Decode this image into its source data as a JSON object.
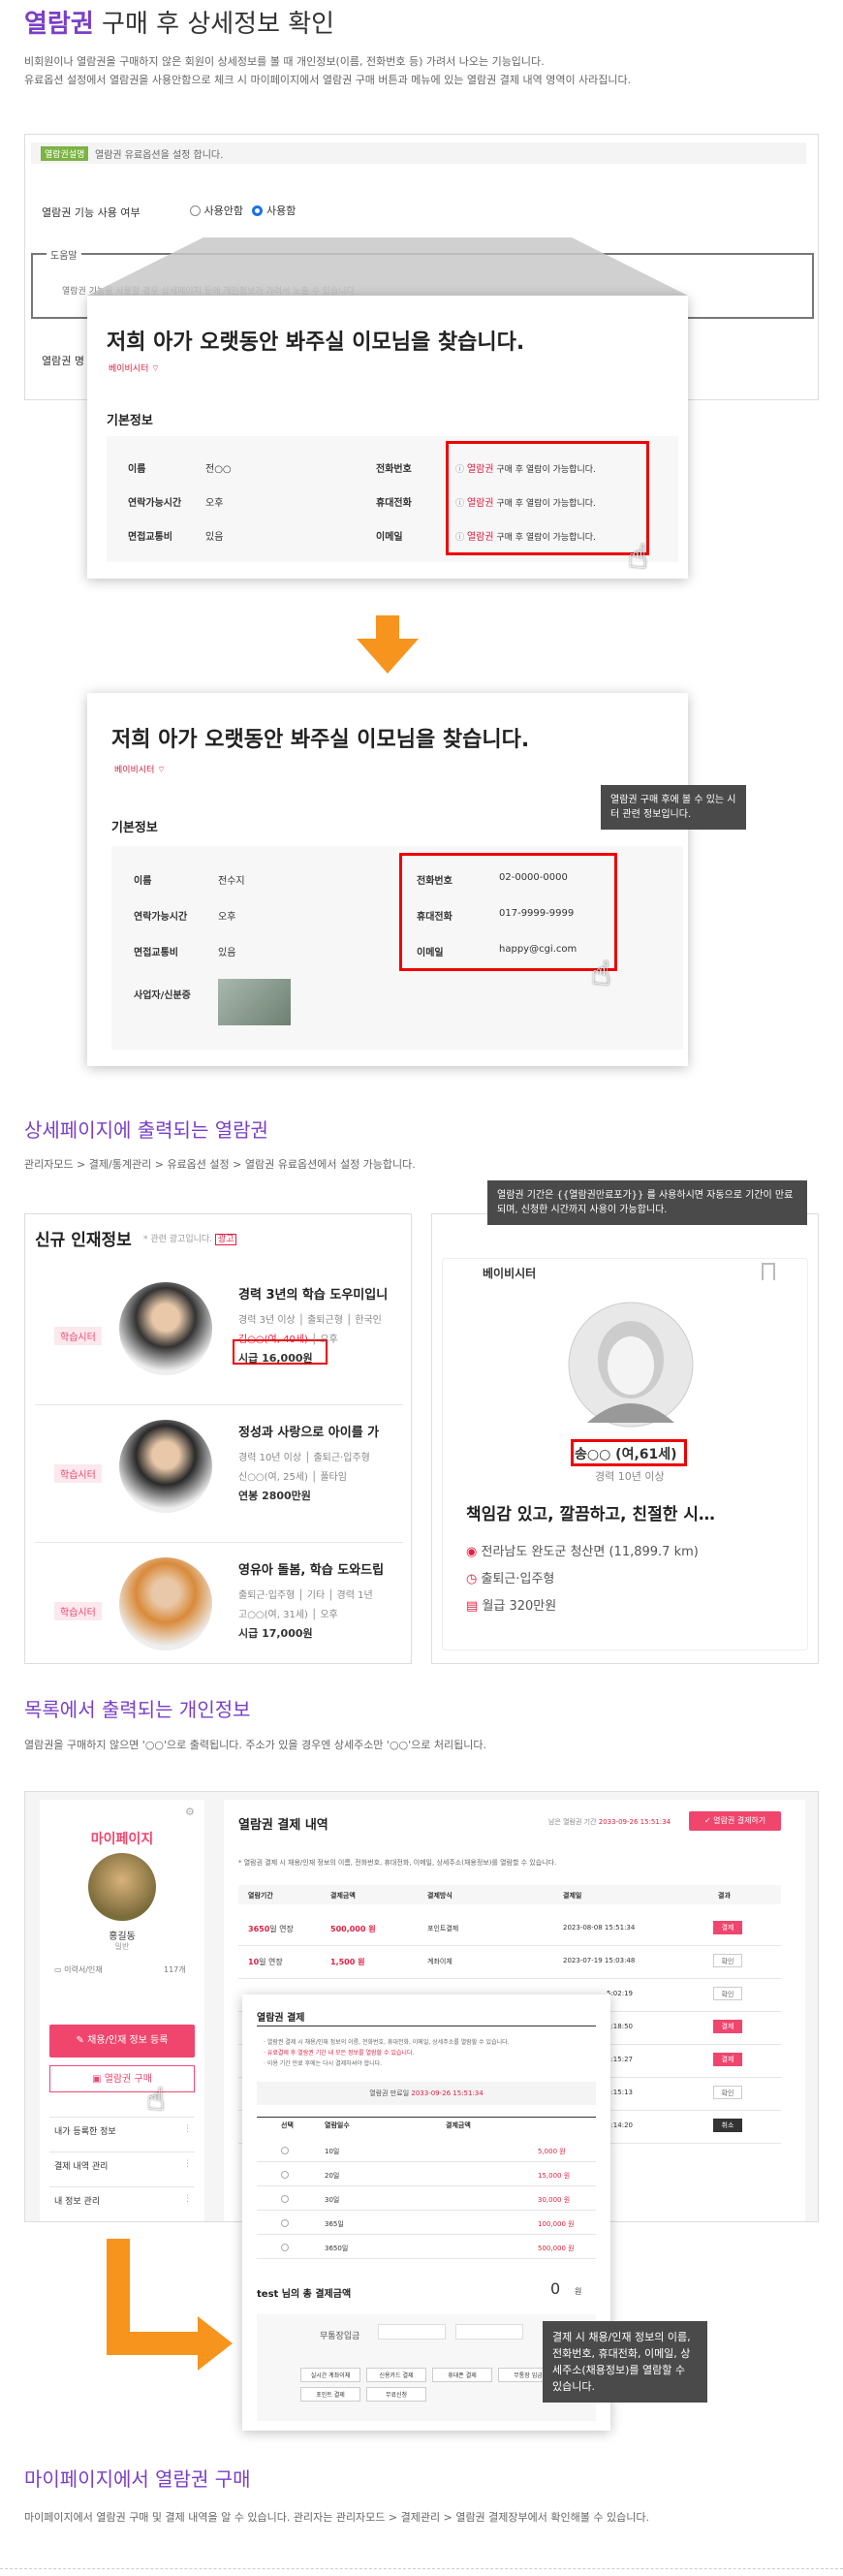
{
  "section1": {
    "title_strong": "열람권",
    "title_rest": " 구매 후 상세정보 확인",
    "desc1": "비회원이나 열람권을 구매하지 않은 회원이 상세정보를 볼 때 개인정보(이름, 전화번호 등) 가려서 나오는 기능입니다.",
    "desc2": "유료옵션 설정에서 열람권을 사용안함으로 체크 시 마이페이지에서 열람권 구매 버튼과 메뉴에 있는 열람권 결제 내역 영역이 사라집니다.",
    "admin_tag": "열람권",
    "admin_tag2": "설명",
    "admin_note": "열람권 유료옵션을 설정 합니다.",
    "use_label": "열람권 기능 사용 여부",
    "opt_off": "사용안함",
    "opt_on": "사용함",
    "help_label": "도움말",
    "help_text": "열람권 기능을 사용할 경우 상세페이지 등에 개인정보가 가려서 노출 수 있습니다.",
    "row2_label": "열람권 명"
  },
  "before_card": {
    "title": "저희 아가 오랫동안 봐주실 이모님을 찾습니다.",
    "badge": "베이비시터",
    "badge_icon": "wifi-icon",
    "section": "기본정보",
    "rows": [
      {
        "l1": "이름",
        "v1": "전○○",
        "l2": "전화번호",
        "lock": "열람권",
        "v2": " 구매 후 열람이 가능합니다."
      },
      {
        "l1": "연락가능시간",
        "v1": "오후",
        "l2": "휴대전화",
        "lock": "열람권",
        "v2": " 구매 후 열람이 가능합니다."
      },
      {
        "l1": "면접교통비",
        "v1": "있음",
        "l2": "이메일",
        "lock": "열람권",
        "v2": " 구매 후 열람이 가능합니다."
      }
    ]
  },
  "after_card": {
    "title": "저희 아가 오랫동안 봐주실 이모님을 찾습니다.",
    "badge": "베이비시터",
    "section": "기본정보",
    "callout": "열람권 구매 후에 볼 수 있는 시터 관련 정보입니다.",
    "rows": [
      {
        "l1": "이름",
        "v1": "전수지",
        "l2": "전화번호",
        "v2": "02-0000-0000"
      },
      {
        "l1": "연락가능시간",
        "v1": "오후",
        "l2": "휴대전화",
        "v2": "017-9999-9999"
      },
      {
        "l1": "면접교통비",
        "v1": "있음",
        "l2": "이메일",
        "v2": "happy@cgi.com"
      }
    ],
    "row4_label": "사업자/신분증"
  },
  "section2": {
    "title": "상세페이지에 출력되는 열람권",
    "desc": "관리자모드 > 결제/통계관리 > 유료옵션 설정 > 열람권 유료옵션에서 설정 가능합니다.",
    "callout": "열람권 기간은 {{열람권만료포가}} 를 사용하시면 자동으로 기간이 만료되며, 신청한 시간까지 사용이 가능합니다."
  },
  "talent_list": {
    "title": "신규 인재정보",
    "sub": "* 관련 광고입니다.",
    "sub_tag": "광고",
    "items": [
      {
        "tag": "학습시터",
        "headline": "경력 3년의 학습 도우미입니",
        "meta1": "경력 3년 이상 │ 출퇴근형 │ 한국인",
        "name": "김○○(여, 40세)",
        "time": "오후",
        "pay": "시급 16,000원"
      },
      {
        "tag": "학습시터",
        "headline": "정성과 사랑으로 아이를 가",
        "meta1": "경력 10년 이상 │ 출퇴근·입주형",
        "name": "신○○(여, 25세)",
        "time": "풀타임",
        "pay": "연봉 2800만원"
      },
      {
        "tag": "학습시터",
        "headline": "영유아 돌봄, 학습 도와드립",
        "meta1": "출퇴근·입주형 │ 기타 │ 경력 1년",
        "name": "고○○(여, 31세)",
        "time": "오후",
        "pay": "시급 17,000원"
      }
    ]
  },
  "profile_card": {
    "tag": "베이비시터",
    "bookmark_icon": "bookmark-icon",
    "name": "송○○ (여,61세)",
    "career": "경력 10년 이상",
    "headline": "책임감 있고, 깔끔하고, 친절한 시…",
    "location": "전라남도 완도군 청산면 (11,899.7 km)",
    "type": "출퇴근·입주형",
    "pay": "월급 320만원"
  },
  "section3": {
    "title": "목록에서 출력되는 개인정보",
    "desc": "열람권을 구매하지 않으면 '○○'으로 출력됩니다. 주소가 있을 경우엔 상세주소만 '○○'으로 처리됩니다."
  },
  "mypage": {
    "side_title": "마이페이지",
    "user": "홍길동",
    "user_sub": "일반",
    "stat_label": "이력서/인재",
    "stat_val": "117개",
    "btn1": "채용/인재 정보 등록",
    "btn2": "열람권 구매",
    "menu": [
      "내가 등록한 정보",
      "결제 내역 관리",
      "내 정보 관리"
    ],
    "main_title": "열람권 결제 내역",
    "period_note": "남은 열람권 기간",
    "period_val": "2033-09-26 15:51:34",
    "pay_btn": "열람권 결제하기",
    "notice": "* 열람권 결제 시 채용/인재 정보의 이름, 전화번호, 휴대전화, 이메일, 상세주소(채용정보)를 열람할 수 있습니다.",
    "cols": [
      "열람기간",
      "결제금액",
      "결제방식",
      "결제일",
      "결과"
    ],
    "rows": [
      {
        "p": "3650",
        "u": "일 연장",
        "a": "500,000 원",
        "m": "포인트결제",
        "d": "2023-08-08 15:51:34",
        "r": "결제"
      },
      {
        "p": "10",
        "u": "일 연장",
        "a": "1,500 원",
        "m": "계좌이체",
        "d": "2023-07-19 15:03:48",
        "r": "확인"
      },
      {
        "d": "5:02:19",
        "r": "확인"
      },
      {
        "d": "8:18:50",
        "r": "결제"
      },
      {
        "d": "8:15:27",
        "r": "결제"
      },
      {
        "d": "8:15:13",
        "r": "확인"
      },
      {
        "d": "8:14:20",
        "r": "취소"
      }
    ]
  },
  "modal": {
    "title": "열람권 결제",
    "notes": [
      "· 열람권 결제 시 채용/인재 정보의 이름, 전화번호, 휴대전화, 이메일, 상세주소를 열람할 수 있습니다.",
      "· 유료결제 후 열람권 기간 내 모든 정보를 열람할 수 있습니다.",
      "· 이용 기간 만료 후에는 다시 결제하셔야 합니다."
    ],
    "period_label": "열람권 만료일",
    "period": "2033-09-26 15:51:34",
    "th": [
      "선택",
      "열람일수",
      "결제금액"
    ],
    "items": [
      {
        "d": "10일",
        "a": "5,000 원"
      },
      {
        "d": "20일",
        "a": "15,000 원"
      },
      {
        "d": "30일",
        "a": "30,000 원"
      },
      {
        "d": "365일",
        "a": "100,000 원"
      },
      {
        "d": "3650일",
        "a": "500,000 원"
      }
    ],
    "total_label": "test 님의 총 결제금액",
    "total": "0",
    "won": "원",
    "pay_methods": [
      "실시간 계좌이체",
      "신용카드 결제",
      "휴대폰 결제",
      "무통장 입금",
      "포인트 결제",
      "무료신청"
    ],
    "point_label": "무통장입금",
    "callout": "결제 시 채용/인재 정보의 이름, 전화번호, 휴대전화, 이메일, 상세주소(채용정보)를 열람할 수 있습니다."
  },
  "section4": {
    "title": "마이페이지에서 열람권 구매",
    "desc": "마이페이지에서 열람권 구매 및 결제 내역을 알 수 있습니다. 관리자는 관리자모드 > 결제관리 > 열람권 결제장부에서 확인해볼 수 있습니다."
  },
  "colors": {
    "accent": "#7a3fc8",
    "pink": "#f0466e",
    "alert": "#e00000",
    "orange": "#f7941d"
  }
}
